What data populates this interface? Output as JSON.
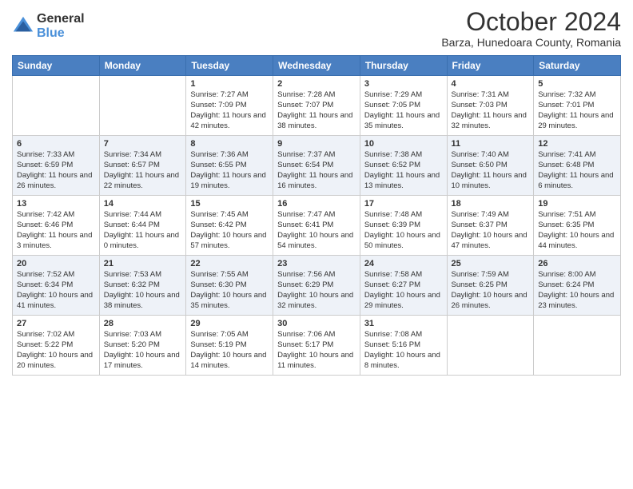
{
  "header": {
    "logo_general": "General",
    "logo_blue": "Blue",
    "month_title": "October 2024",
    "subtitle": "Barza, Hunedoara County, Romania"
  },
  "weekdays": [
    "Sunday",
    "Monday",
    "Tuesday",
    "Wednesday",
    "Thursday",
    "Friday",
    "Saturday"
  ],
  "weeks": [
    [
      {
        "day": "",
        "sunrise": "",
        "sunset": "",
        "daylight": ""
      },
      {
        "day": "",
        "sunrise": "",
        "sunset": "",
        "daylight": ""
      },
      {
        "day": "1",
        "sunrise": "Sunrise: 7:27 AM",
        "sunset": "Sunset: 7:09 PM",
        "daylight": "Daylight: 11 hours and 42 minutes."
      },
      {
        "day": "2",
        "sunrise": "Sunrise: 7:28 AM",
        "sunset": "Sunset: 7:07 PM",
        "daylight": "Daylight: 11 hours and 38 minutes."
      },
      {
        "day": "3",
        "sunrise": "Sunrise: 7:29 AM",
        "sunset": "Sunset: 7:05 PM",
        "daylight": "Daylight: 11 hours and 35 minutes."
      },
      {
        "day": "4",
        "sunrise": "Sunrise: 7:31 AM",
        "sunset": "Sunset: 7:03 PM",
        "daylight": "Daylight: 11 hours and 32 minutes."
      },
      {
        "day": "5",
        "sunrise": "Sunrise: 7:32 AM",
        "sunset": "Sunset: 7:01 PM",
        "daylight": "Daylight: 11 hours and 29 minutes."
      }
    ],
    [
      {
        "day": "6",
        "sunrise": "Sunrise: 7:33 AM",
        "sunset": "Sunset: 6:59 PM",
        "daylight": "Daylight: 11 hours and 26 minutes."
      },
      {
        "day": "7",
        "sunrise": "Sunrise: 7:34 AM",
        "sunset": "Sunset: 6:57 PM",
        "daylight": "Daylight: 11 hours and 22 minutes."
      },
      {
        "day": "8",
        "sunrise": "Sunrise: 7:36 AM",
        "sunset": "Sunset: 6:55 PM",
        "daylight": "Daylight: 11 hours and 19 minutes."
      },
      {
        "day": "9",
        "sunrise": "Sunrise: 7:37 AM",
        "sunset": "Sunset: 6:54 PM",
        "daylight": "Daylight: 11 hours and 16 minutes."
      },
      {
        "day": "10",
        "sunrise": "Sunrise: 7:38 AM",
        "sunset": "Sunset: 6:52 PM",
        "daylight": "Daylight: 11 hours and 13 minutes."
      },
      {
        "day": "11",
        "sunrise": "Sunrise: 7:40 AM",
        "sunset": "Sunset: 6:50 PM",
        "daylight": "Daylight: 11 hours and 10 minutes."
      },
      {
        "day": "12",
        "sunrise": "Sunrise: 7:41 AM",
        "sunset": "Sunset: 6:48 PM",
        "daylight": "Daylight: 11 hours and 6 minutes."
      }
    ],
    [
      {
        "day": "13",
        "sunrise": "Sunrise: 7:42 AM",
        "sunset": "Sunset: 6:46 PM",
        "daylight": "Daylight: 11 hours and 3 minutes."
      },
      {
        "day": "14",
        "sunrise": "Sunrise: 7:44 AM",
        "sunset": "Sunset: 6:44 PM",
        "daylight": "Daylight: 11 hours and 0 minutes."
      },
      {
        "day": "15",
        "sunrise": "Sunrise: 7:45 AM",
        "sunset": "Sunset: 6:42 PM",
        "daylight": "Daylight: 10 hours and 57 minutes."
      },
      {
        "day": "16",
        "sunrise": "Sunrise: 7:47 AM",
        "sunset": "Sunset: 6:41 PM",
        "daylight": "Daylight: 10 hours and 54 minutes."
      },
      {
        "day": "17",
        "sunrise": "Sunrise: 7:48 AM",
        "sunset": "Sunset: 6:39 PM",
        "daylight": "Daylight: 10 hours and 50 minutes."
      },
      {
        "day": "18",
        "sunrise": "Sunrise: 7:49 AM",
        "sunset": "Sunset: 6:37 PM",
        "daylight": "Daylight: 10 hours and 47 minutes."
      },
      {
        "day": "19",
        "sunrise": "Sunrise: 7:51 AM",
        "sunset": "Sunset: 6:35 PM",
        "daylight": "Daylight: 10 hours and 44 minutes."
      }
    ],
    [
      {
        "day": "20",
        "sunrise": "Sunrise: 7:52 AM",
        "sunset": "Sunset: 6:34 PM",
        "daylight": "Daylight: 10 hours and 41 minutes."
      },
      {
        "day": "21",
        "sunrise": "Sunrise: 7:53 AM",
        "sunset": "Sunset: 6:32 PM",
        "daylight": "Daylight: 10 hours and 38 minutes."
      },
      {
        "day": "22",
        "sunrise": "Sunrise: 7:55 AM",
        "sunset": "Sunset: 6:30 PM",
        "daylight": "Daylight: 10 hours and 35 minutes."
      },
      {
        "day": "23",
        "sunrise": "Sunrise: 7:56 AM",
        "sunset": "Sunset: 6:29 PM",
        "daylight": "Daylight: 10 hours and 32 minutes."
      },
      {
        "day": "24",
        "sunrise": "Sunrise: 7:58 AM",
        "sunset": "Sunset: 6:27 PM",
        "daylight": "Daylight: 10 hours and 29 minutes."
      },
      {
        "day": "25",
        "sunrise": "Sunrise: 7:59 AM",
        "sunset": "Sunset: 6:25 PM",
        "daylight": "Daylight: 10 hours and 26 minutes."
      },
      {
        "day": "26",
        "sunrise": "Sunrise: 8:00 AM",
        "sunset": "Sunset: 6:24 PM",
        "daylight": "Daylight: 10 hours and 23 minutes."
      }
    ],
    [
      {
        "day": "27",
        "sunrise": "Sunrise: 7:02 AM",
        "sunset": "Sunset: 5:22 PM",
        "daylight": "Daylight: 10 hours and 20 minutes."
      },
      {
        "day": "28",
        "sunrise": "Sunrise: 7:03 AM",
        "sunset": "Sunset: 5:20 PM",
        "daylight": "Daylight: 10 hours and 17 minutes."
      },
      {
        "day": "29",
        "sunrise": "Sunrise: 7:05 AM",
        "sunset": "Sunset: 5:19 PM",
        "daylight": "Daylight: 10 hours and 14 minutes."
      },
      {
        "day": "30",
        "sunrise": "Sunrise: 7:06 AM",
        "sunset": "Sunset: 5:17 PM",
        "daylight": "Daylight: 10 hours and 11 minutes."
      },
      {
        "day": "31",
        "sunrise": "Sunrise: 7:08 AM",
        "sunset": "Sunset: 5:16 PM",
        "daylight": "Daylight: 10 hours and 8 minutes."
      },
      {
        "day": "",
        "sunrise": "",
        "sunset": "",
        "daylight": ""
      },
      {
        "day": "",
        "sunrise": "",
        "sunset": "",
        "daylight": ""
      }
    ]
  ]
}
